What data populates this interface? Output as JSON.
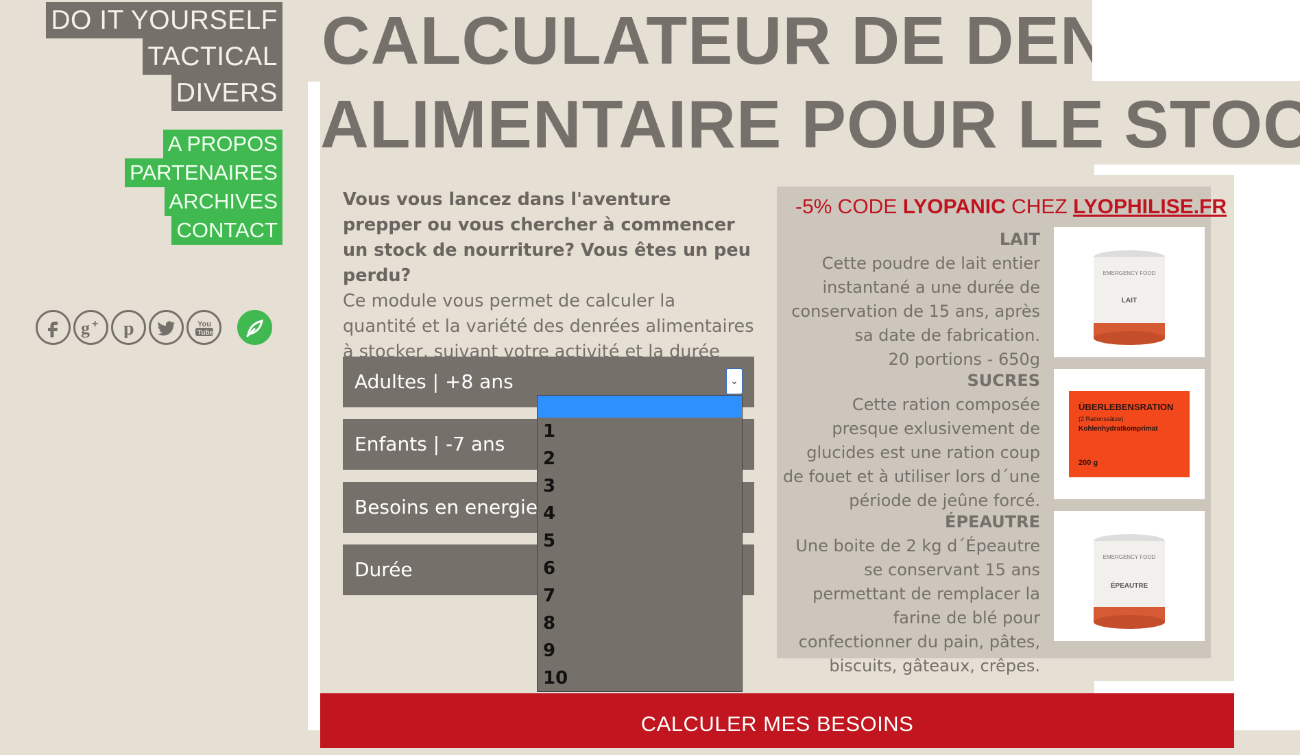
{
  "nav": {
    "top_items": [
      "DO IT YOURSELF",
      "TACTICAL",
      "DIVERS"
    ],
    "green_items": [
      "A PROPOS",
      "PARTENAIRES",
      "ARCHIVES",
      "CONTACT"
    ]
  },
  "socials": [
    "facebook-icon",
    "google-plus-icon",
    "pinterest-icon",
    "twitter-icon",
    "youtube-icon",
    "leaf-logo-icon"
  ],
  "title": {
    "line1": "CALCULATEUR DE DENRÉE",
    "line2": "ALIMENTAIRE POUR LE STOCKAGE"
  },
  "intro": {
    "bold": "Vous vous lancez dans l'aventure prepper ou vous chercher à commencer un stock de nourriture? Vous êtes un peu perdu?",
    "text": "Ce module vous permet de calculer la quantité et la variété des denrées alimentaires à stocker, suivant votre activité et la durée choisie."
  },
  "fields": {
    "adultes": "Adultes | +8 ans",
    "enfants": "Enfants | -7 ans",
    "energie": "Besoins en energie",
    "duree": "Durée"
  },
  "dropdown": {
    "options": [
      "",
      "1",
      "2",
      "3",
      "4",
      "5",
      "6",
      "7",
      "8",
      "9",
      "10"
    ]
  },
  "promo": {
    "prefix": "-5% CODE ",
    "code": "LYOPANIC",
    "middle": " CHEZ ",
    "site": "LYOPHILISE.FR",
    "products": [
      {
        "title": "LAIT",
        "desc": "Cette poudre de lait entier instantané a une durée de conservation de 15 ans, après sa date de fabrication.",
        "extra": "20 portions - 650g",
        "img_label": "LAIT",
        "img_brand": "EMERGENCY FOOD"
      },
      {
        "title": "SUCRES",
        "desc": "Cette ration composée presque exlusivement de glucides est une ration coup de fouet et à utiliser lors d´une période de jeûne forcé.",
        "img_line1": "ÜBERLEBENSRATION",
        "img_line2": "(2 Rationssätze)",
        "img_line3": "Kohlenhydratkomprimat",
        "img_line4": "200 g"
      },
      {
        "title": "ÉPEAUTRE",
        "desc": "Une boite de 2 kg d´Épeautre se conservant 15 ans permettant de remplacer la farine de blé pour confectionner du pain, pâtes, biscuits, gâteaux, crêpes.",
        "img_label": "ÉPEAUTRE",
        "img_brand": "EMERGENCY FOOD"
      }
    ]
  },
  "button": {
    "calc_label": "CALCULER MES BESOINS"
  },
  "colors": {
    "accent_red": "#c1161f",
    "green": "#3fb950",
    "taupe": "#75706a",
    "background": "#e6dfd4"
  }
}
